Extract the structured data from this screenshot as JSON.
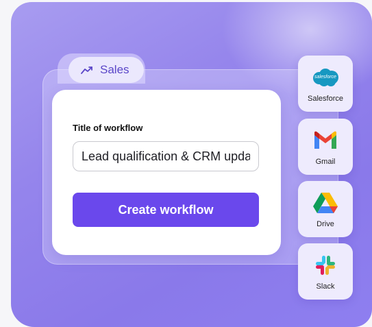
{
  "folder": {
    "tab_label": "Sales",
    "tab_icon": "trending-up-icon"
  },
  "form": {
    "field_label": "Title of workflow",
    "title_value": "Lead qualification & CRM updates",
    "create_button_label": "Create workflow"
  },
  "apps": [
    {
      "name": "Salesforce",
      "icon": "salesforce-logo-icon",
      "logo_text": "salesforce"
    },
    {
      "name": "Gmail",
      "icon": "gmail-logo-icon"
    },
    {
      "name": "Drive",
      "icon": "google-drive-logo-icon"
    },
    {
      "name": "Slack",
      "icon": "slack-logo-icon"
    }
  ],
  "colors": {
    "accent": "#6a48ec",
    "background": "#9585ec",
    "tab_text": "#5a46c8"
  }
}
